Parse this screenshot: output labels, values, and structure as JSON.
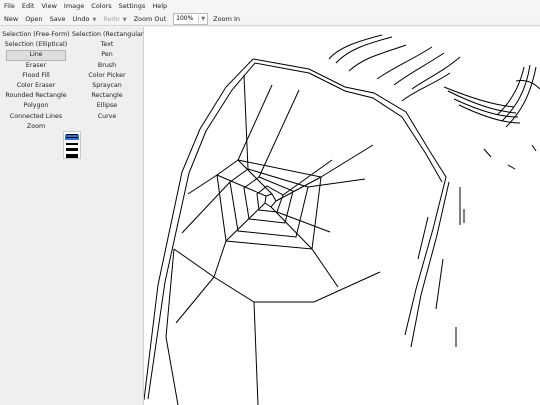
{
  "menu": [
    "File",
    "Edit",
    "View",
    "Image",
    "Colors",
    "Settings",
    "Help"
  ],
  "toolbar": {
    "new": "New",
    "open": "Open",
    "save": "Save",
    "undo": "Undo",
    "redo": "Redo",
    "zoom_out": "Zoom Out",
    "zoom_value": "100%",
    "zoom_in": "Zoom In"
  },
  "tools": [
    {
      "label": "Selection (Free-Form)",
      "selected": false
    },
    {
      "label": "Selection (Rectangular)",
      "selected": false
    },
    {
      "label": "Selection (Elliptical)",
      "selected": false
    },
    {
      "label": "Text",
      "selected": false
    },
    {
      "label": "Line",
      "selected": true
    },
    {
      "label": "Pen",
      "selected": false
    },
    {
      "label": "Eraser",
      "selected": false
    },
    {
      "label": "Brush",
      "selected": false
    },
    {
      "label": "Flood Fill",
      "selected": false
    },
    {
      "label": "Color Picker",
      "selected": false
    },
    {
      "label": "Color Eraser",
      "selected": false
    },
    {
      "label": "Spraycan",
      "selected": false
    },
    {
      "label": "Rounded Rectangle",
      "selected": false
    },
    {
      "label": "Rectangle",
      "selected": false
    },
    {
      "label": "Polygon",
      "selected": false
    },
    {
      "label": "Ellipse",
      "selected": false
    },
    {
      "label": "Connected Lines",
      "selected": false
    },
    {
      "label": "Curve",
      "selected": false
    },
    {
      "label": "Zoom",
      "selected": false
    }
  ],
  "line_widths": {
    "options_count": 5,
    "selected_index": 1,
    "selected_color": "#2e6fd8"
  },
  "colors": {
    "accent": "#2e6fd8",
    "stroke": "#000000",
    "canvas": "#ffffff"
  }
}
